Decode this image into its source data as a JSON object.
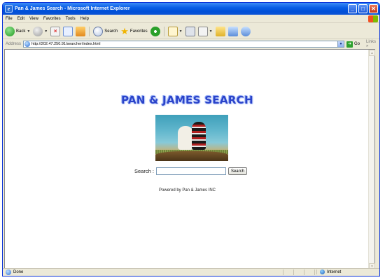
{
  "window": {
    "title": "Pan & James Search - Microsoft Internet Explorer"
  },
  "menu": [
    "File",
    "Edit",
    "View",
    "Favorites",
    "Tools",
    "Help"
  ],
  "toolbar": {
    "back_label": "Back",
    "search_label": "Search",
    "favorites_label": "Favorites"
  },
  "address": {
    "label": "Address",
    "url": "http://202.47.250.91/searcher/index.html",
    "go_label": "Go",
    "links_label": "Links"
  },
  "page": {
    "logo_text": "PAN & JAMES SEARCH",
    "search_label": "Search :",
    "search_value": "",
    "search_button": "Search",
    "footer": "Powered by Pan & James INC"
  },
  "status": {
    "text": "Done",
    "zone": "Internet"
  }
}
